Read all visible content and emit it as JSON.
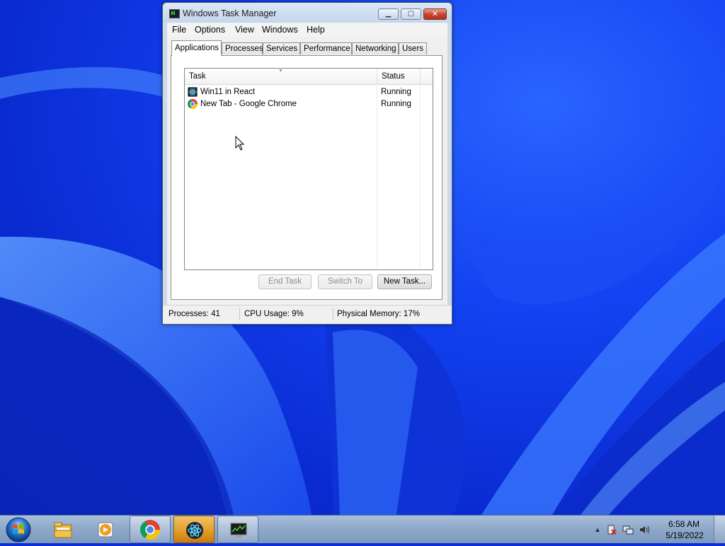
{
  "window": {
    "title": "Windows Task Manager",
    "controls": {
      "minimize": "▁",
      "maximize": "▢",
      "close": "✕"
    }
  },
  "menu": [
    "File",
    "Options",
    "View",
    "Windows",
    "Help"
  ],
  "tabs": [
    "Applications",
    "Processes",
    "Services",
    "Performance",
    "Networking",
    "Users"
  ],
  "active_tab": "Applications",
  "task_list": {
    "columns": [
      "Task",
      "Status"
    ],
    "rows": [
      {
        "name": "Win11 in React",
        "status": "Running",
        "icon": "react-icon"
      },
      {
        "name": "New Tab - Google Chrome",
        "status": "Running",
        "icon": "chrome-icon"
      }
    ]
  },
  "buttons": {
    "end_task": "End Task",
    "switch_to": "Switch To",
    "new_task": "New Task..."
  },
  "status_bar": {
    "processes": "Processes: 41",
    "cpu": "CPU Usage: 9%",
    "memory": "Physical Memory: 17%"
  },
  "taskbar": {
    "items": [
      "start-orb-icon",
      "file-explorer-icon",
      "media-player-icon",
      "chrome-icon",
      "react-icon",
      "task-manager-icon"
    ],
    "clock": {
      "time": "6:58 AM",
      "date": "5/19/2022"
    }
  },
  "colors": {
    "desktop": "#0a2fd8",
    "close_button": "#c4412a",
    "active_taskbar": "#e29b23"
  }
}
